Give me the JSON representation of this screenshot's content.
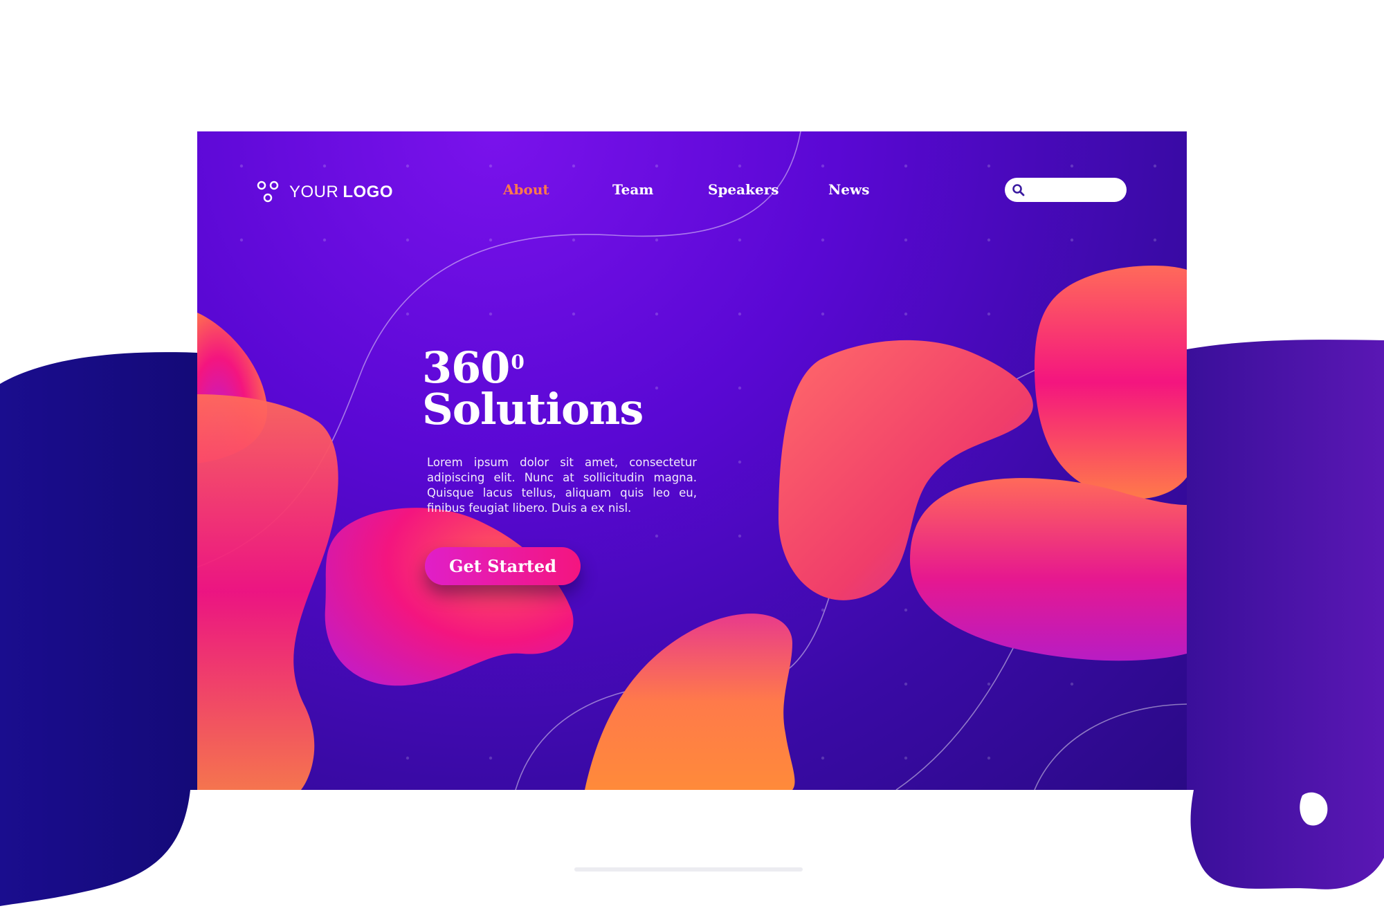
{
  "logo": {
    "icon": "three-circles-icon",
    "text_regular": "YOUR",
    "text_bold": "LOGO"
  },
  "nav": {
    "items": [
      {
        "label": "About",
        "active": true
      },
      {
        "label": "Team",
        "active": false
      },
      {
        "label": "Speakers",
        "active": false
      },
      {
        "label": "News",
        "active": false
      }
    ]
  },
  "search": {
    "icon": "search-icon",
    "value": "",
    "placeholder": ""
  },
  "hero": {
    "title_line1": "360",
    "title_sup": "0",
    "title_line2": "Solutions",
    "body": "Lorem ipsum dolor sit amet, consectetur adipiscing elit. Nunc at sollicitudin magna. Quisque lacus tellus, aliquam quis leo eu, finibus feugiat libero. Duis a ex nisl.",
    "cta_label": "Get Started"
  },
  "colors": {
    "background_purple": "#5a08d4",
    "deep_purple": "#2a0a86",
    "blob_orange": "#ff7a4a",
    "blob_pink": "#f4157f",
    "blob_magenta": "#c21cc8",
    "active_nav": "#ff7a4a",
    "cta_gradient_start": "#e01fc8",
    "cta_gradient_end": "#f4157f"
  }
}
